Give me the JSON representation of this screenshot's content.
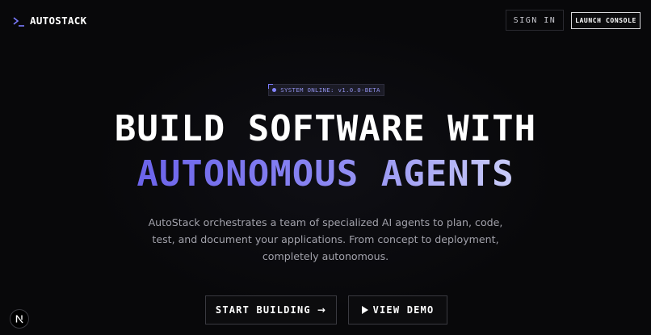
{
  "header": {
    "brand": "AUTOSTACK",
    "logo_icon": "terminal-prompt-icon",
    "sign_in_label": "SIGN IN",
    "launch_console_label": "LAUNCH CONSOLE"
  },
  "hero": {
    "badge_text": "SYSTEM ONLINE: v1.0.0-BETA",
    "headline_line1": "BUILD SOFTWARE WITH",
    "headline_line2": "AUTONOMOUS AGENTS",
    "subtitle_line1": "AutoStack orchestrates a team of specialized AI agents to plan, code,",
    "subtitle_line2": "test, and document your applications. From concept to deployment,",
    "subtitle_line3": "completely autonomous.",
    "primary_cta_label": "START BUILDING",
    "primary_cta_icon": "arrow-right-icon",
    "secondary_cta_label": "VIEW DEMO",
    "secondary_cta_icon": "play-icon"
  },
  "dev_badge": {
    "icon": "nextjs-logo-icon"
  },
  "colors": {
    "background": "#08080a",
    "accent": "#7b7bff",
    "gradient_start": "#6b63ea",
    "gradient_end": "#c9ccf8"
  }
}
